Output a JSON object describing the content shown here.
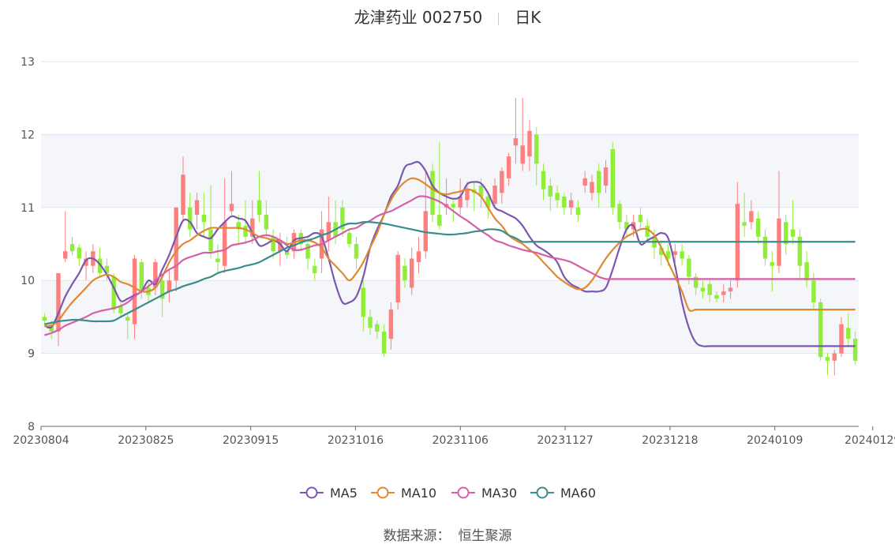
{
  "header": {
    "title": "龙津药业 002750",
    "period": "日K"
  },
  "source": {
    "label": "数据来源：",
    "value": "恒生聚源"
  },
  "colors": {
    "up": "#ff7f7f",
    "down": "#90ee3a",
    "ma5": "#7a58b0",
    "ma10": "#e08a30",
    "ma30": "#d461a8",
    "ma60": "#3b8c8c",
    "grid": "#dfe4f0",
    "band": "#f5f6fa"
  },
  "chart_data": {
    "type": "candlestick",
    "title": "龙津药业 002750",
    "ylim": [
      8,
      13
    ],
    "y_ticks": [
      "8",
      "9",
      "10",
      "11",
      "12",
      "13"
    ],
    "x_tick_labels": [
      "20230804",
      "20230825",
      "20230915",
      "20231016",
      "20231106",
      "20231127",
      "20231218",
      "20240109",
      "20240129"
    ],
    "x_tick_index": [
      0,
      15,
      30,
      45,
      60,
      75,
      90,
      105,
      119
    ],
    "legend_position": "bottom",
    "series": [
      {
        "name": "MA5",
        "color": "#7a58b0",
        "values": [
          9.38,
          9.36,
          9.55,
          9.78,
          9.95,
          10.1,
          10.28,
          10.3,
          10.22,
          10.08,
          9.9,
          9.72,
          9.75,
          9.8,
          9.85,
          10.0,
          9.95,
          10.15,
          10.35,
          10.6,
          10.82,
          10.8,
          10.65,
          10.6,
          10.58,
          10.7,
          10.8,
          10.88,
          10.85,
          10.82,
          10.65,
          10.48,
          10.5,
          10.55,
          10.5,
          10.4,
          10.55,
          10.58,
          10.6,
          10.65,
          10.6,
          10.3,
          9.95,
          9.7,
          9.7,
          9.78,
          10.05,
          10.45,
          10.7,
          10.9,
          11.15,
          11.3,
          11.55,
          11.6,
          11.62,
          11.5,
          11.3,
          11.2,
          11.15,
          11.12,
          11.15,
          11.32,
          11.35,
          11.33,
          11.2,
          11.0,
          10.95,
          10.9,
          10.85,
          10.75,
          10.6,
          10.48,
          10.42,
          10.35,
          10.25,
          10.05,
          9.95,
          9.9,
          9.85,
          9.85,
          9.85,
          9.9,
          10.15,
          10.45,
          10.7,
          10.75,
          10.5,
          10.55,
          10.6,
          10.65,
          10.58,
          10.2,
          9.7,
          9.35,
          9.15,
          9.1,
          9.1,
          9.1,
          9.1,
          9.1,
          9.1,
          9.1,
          9.1,
          9.1,
          9.1,
          9.1,
          9.1,
          9.1,
          9.1,
          9.1,
          9.1,
          9.1,
          9.1,
          9.1,
          9.1,
          9.1,
          9.1,
          9.1,
          9.1,
          9.1
        ]
      },
      {
        "name": "MA10",
        "color": "#e08a30",
        "values": [
          9.38,
          9.38,
          9.45,
          9.58,
          9.7,
          9.8,
          9.9,
          10.0,
          10.05,
          10.08,
          10.05,
          9.98,
          9.95,
          9.9,
          9.85,
          9.85,
          9.9,
          10.05,
          10.25,
          10.4,
          10.5,
          10.55,
          10.62,
          10.68,
          10.72,
          10.72,
          10.72,
          10.72,
          10.72,
          10.7,
          10.65,
          10.6,
          10.58,
          10.55,
          10.55,
          10.5,
          10.52,
          10.55,
          10.55,
          10.52,
          10.45,
          10.3,
          10.2,
          10.1,
          10.0,
          10.1,
          10.25,
          10.45,
          10.65,
          10.9,
          11.1,
          11.25,
          11.35,
          11.4,
          11.38,
          11.32,
          11.25,
          11.2,
          11.18,
          11.2,
          11.22,
          11.25,
          11.22,
          11.15,
          11.0,
          10.85,
          10.75,
          10.62,
          10.55,
          10.5,
          10.42,
          10.35,
          10.25,
          10.15,
          10.05,
          9.98,
          9.92,
          9.88,
          9.9,
          10.0,
          10.15,
          10.3,
          10.42,
          10.52,
          10.6,
          10.65,
          10.7,
          10.7,
          10.62,
          10.45,
          10.25,
          10.05,
          9.85,
          9.6,
          9.6,
          9.6,
          9.6,
          9.6,
          9.6,
          9.6,
          9.6,
          9.6,
          9.6,
          9.6,
          9.6,
          9.6,
          9.6,
          9.6,
          9.6,
          9.6,
          9.6,
          9.6,
          9.6,
          9.6,
          9.6,
          9.6,
          9.6,
          9.6,
          9.6,
          9.6
        ]
      },
      {
        "name": "MA30",
        "color": "#d461a8",
        "values": [
          9.25,
          9.28,
          9.32,
          9.38,
          9.42,
          9.46,
          9.5,
          9.55,
          9.58,
          9.6,
          9.62,
          9.65,
          9.7,
          9.78,
          9.85,
          9.92,
          10.0,
          10.08,
          10.15,
          10.2,
          10.28,
          10.32,
          10.35,
          10.38,
          10.38,
          10.4,
          10.42,
          10.48,
          10.5,
          10.52,
          10.55,
          10.6,
          10.62,
          10.6,
          10.55,
          10.48,
          10.42,
          10.42,
          10.45,
          10.48,
          10.5,
          10.55,
          10.6,
          10.65,
          10.7,
          10.72,
          10.78,
          10.82,
          10.88,
          10.92,
          10.95,
          11.0,
          11.05,
          11.1,
          11.15,
          11.15,
          11.12,
          11.08,
          11.02,
          10.95,
          10.88,
          10.82,
          10.75,
          10.68,
          10.62,
          10.55,
          10.52,
          10.48,
          10.45,
          10.42,
          10.4,
          10.38,
          10.35,
          10.32,
          10.3,
          10.28,
          10.25,
          10.2,
          10.15,
          10.1,
          10.05,
          10.02,
          10.02,
          10.02,
          10.02,
          10.02,
          10.02,
          10.02,
          10.02,
          10.02,
          10.02,
          10.02,
          10.02,
          10.02,
          10.02,
          10.02,
          10.02,
          10.02,
          10.02,
          10.02,
          10.02,
          10.02,
          10.02,
          10.02,
          10.02,
          10.02,
          10.02,
          10.02,
          10.02,
          10.02,
          10.02,
          10.02,
          10.02,
          10.02,
          10.02,
          10.02,
          10.02,
          10.02,
          10.02,
          10.02
        ]
      },
      {
        "name": "MA60",
        "color": "#3b8c8c",
        "values": [
          9.4,
          9.42,
          9.44,
          9.45,
          9.46,
          9.46,
          9.45,
          9.44,
          9.44,
          9.44,
          9.45,
          9.5,
          9.55,
          9.6,
          9.65,
          9.7,
          9.75,
          9.8,
          9.85,
          9.88,
          9.92,
          9.95,
          9.98,
          10.02,
          10.05,
          10.1,
          10.13,
          10.15,
          10.17,
          10.2,
          10.22,
          10.25,
          10.3,
          10.35,
          10.4,
          10.45,
          10.48,
          10.52,
          10.55,
          10.58,
          10.62,
          10.65,
          10.7,
          10.75,
          10.78,
          10.78,
          10.8,
          10.8,
          10.79,
          10.78,
          10.76,
          10.74,
          10.72,
          10.7,
          10.68,
          10.66,
          10.65,
          10.64,
          10.63,
          10.63,
          10.64,
          10.65,
          10.67,
          10.68,
          10.7,
          10.7,
          10.68,
          10.62,
          10.58,
          10.53,
          10.53,
          10.53,
          10.53,
          10.53,
          10.53,
          10.53,
          10.53,
          10.53,
          10.53,
          10.53,
          10.53,
          10.53,
          10.53,
          10.53,
          10.53,
          10.53,
          10.53,
          10.53,
          10.53,
          10.53,
          10.53,
          10.53,
          10.53,
          10.53,
          10.53,
          10.53,
          10.53,
          10.53,
          10.53,
          10.53,
          10.53,
          10.53,
          10.53,
          10.53,
          10.53,
          10.53,
          10.53,
          10.53,
          10.53,
          10.53,
          10.53,
          10.53,
          10.53,
          10.53,
          10.53,
          10.53,
          10.53,
          10.53,
          10.53,
          10.53
        ]
      }
    ],
    "candles": [
      [
        9.5,
        9.45,
        9.55,
        9.4
      ],
      [
        9.4,
        9.3,
        9.45,
        9.2
      ],
      [
        9.3,
        10.1,
        10.1,
        9.1
      ],
      [
        10.3,
        10.4,
        10.95,
        10.25
      ],
      [
        10.5,
        10.4,
        10.6,
        10.35
      ],
      [
        10.45,
        10.3,
        10.5,
        10.2
      ],
      [
        10.2,
        10.3,
        10.4,
        10.0
      ],
      [
        10.2,
        10.4,
        10.5,
        10.1
      ],
      [
        10.3,
        10.1,
        10.45,
        10.05
      ],
      [
        10.2,
        10.1,
        10.3,
        10.0
      ],
      [
        10.05,
        9.6,
        10.1,
        9.55
      ],
      [
        9.65,
        9.55,
        9.7,
        9.5
      ],
      [
        9.5,
        9.45,
        9.55,
        9.2
      ],
      [
        9.4,
        10.3,
        10.35,
        9.2
      ],
      [
        10.25,
        9.85,
        10.3,
        9.75
      ],
      [
        9.9,
        9.8,
        10.0,
        9.7
      ],
      [
        9.9,
        10.25,
        10.3,
        9.8
      ],
      [
        10.0,
        9.75,
        10.05,
        9.5
      ],
      [
        9.85,
        10.0,
        10.15,
        9.7
      ],
      [
        10.0,
        11.0,
        11.0,
        9.85
      ],
      [
        10.9,
        11.45,
        11.7,
        10.8
      ],
      [
        11.0,
        10.7,
        11.2,
        10.6
      ],
      [
        10.9,
        11.1,
        11.2,
        10.7
      ],
      [
        10.9,
        10.8,
        11.2,
        10.6
      ],
      [
        10.7,
        10.4,
        11.3,
        10.3
      ],
      [
        10.3,
        10.25,
        10.5,
        10.1
      ],
      [
        10.2,
        10.8,
        11.4,
        10.1
      ],
      [
        10.95,
        11.05,
        11.5,
        10.9
      ],
      [
        10.8,
        10.7,
        10.9,
        10.5
      ],
      [
        10.75,
        10.6,
        11.1,
        10.5
      ],
      [
        10.6,
        10.85,
        11.1,
        10.5
      ],
      [
        11.1,
        10.9,
        11.5,
        10.8
      ],
      [
        10.9,
        10.7,
        11.1,
        10.6
      ],
      [
        10.6,
        10.4,
        10.7,
        10.3
      ],
      [
        10.4,
        10.55,
        10.65,
        10.2
      ],
      [
        10.4,
        10.35,
        10.6,
        10.3
      ],
      [
        10.4,
        10.65,
        10.7,
        10.3
      ],
      [
        10.65,
        10.5,
        10.7,
        10.4
      ],
      [
        10.5,
        10.3,
        10.6,
        10.15
      ],
      [
        10.2,
        10.1,
        10.3,
        10.0
      ],
      [
        10.3,
        10.7,
        10.95,
        10.1
      ],
      [
        10.55,
        10.8,
        11.15,
        10.4
      ],
      [
        10.8,
        10.6,
        11.1,
        10.5
      ],
      [
        11.0,
        10.7,
        11.1,
        10.6
      ],
      [
        10.65,
        10.5,
        10.7,
        10.45
      ],
      [
        10.5,
        10.3,
        10.6,
        10.15
      ],
      [
        9.9,
        9.5,
        10.0,
        9.3
      ],
      [
        9.5,
        9.35,
        9.6,
        9.25
      ],
      [
        9.4,
        9.3,
        9.45,
        9.2
      ],
      [
        9.3,
        9.0,
        9.4,
        8.95
      ],
      [
        9.2,
        9.6,
        9.7,
        9.05
      ],
      [
        9.7,
        10.35,
        10.4,
        9.6
      ],
      [
        10.2,
        10.0,
        10.3,
        9.9
      ],
      [
        9.9,
        10.3,
        10.45,
        9.8
      ],
      [
        10.25,
        10.4,
        10.6,
        10.1
      ],
      [
        10.4,
        10.95,
        11.5,
        10.3
      ],
      [
        11.5,
        10.9,
        11.6,
        10.8
      ],
      [
        10.9,
        10.75,
        11.9,
        10.7
      ],
      [
        11.0,
        11.05,
        11.4,
        10.9
      ],
      [
        11.05,
        11.0,
        11.1,
        10.8
      ],
      [
        11.0,
        11.15,
        11.4,
        10.9
      ],
      [
        11.1,
        11.25,
        11.35,
        11.0
      ],
      [
        11.25,
        11.2,
        11.35,
        10.95
      ],
      [
        11.3,
        11.15,
        11.4,
        11.0
      ],
      [
        11.15,
        11.0,
        11.2,
        10.85
      ],
      [
        11.05,
        11.3,
        11.4,
        11.0
      ],
      [
        11.2,
        11.5,
        11.55,
        11.05
      ],
      [
        11.4,
        11.7,
        11.75,
        11.3
      ],
      [
        11.85,
        11.95,
        12.5,
        11.6
      ],
      [
        11.6,
        11.85,
        12.5,
        11.5
      ],
      [
        11.7,
        12.05,
        12.2,
        11.5
      ],
      [
        12.0,
        11.6,
        12.1,
        11.3
      ],
      [
        11.5,
        11.25,
        11.6,
        11.1
      ],
      [
        11.3,
        11.15,
        11.4,
        10.95
      ],
      [
        11.2,
        11.1,
        11.3,
        11.0
      ],
      [
        11.15,
        11.0,
        11.2,
        10.9
      ],
      [
        11.0,
        11.1,
        11.2,
        10.9
      ],
      [
        11.0,
        10.9,
        11.1,
        10.8
      ],
      [
        11.3,
        11.4,
        11.5,
        11.2
      ],
      [
        11.2,
        11.35,
        11.45,
        11.1
      ],
      [
        11.5,
        11.2,
        11.6,
        11.0
      ],
      [
        11.3,
        11.55,
        11.65,
        11.2
      ],
      [
        11.8,
        11.0,
        11.9,
        10.9
      ],
      [
        11.05,
        10.8,
        11.1,
        10.7
      ],
      [
        10.8,
        10.7,
        10.9,
        10.6
      ],
      [
        10.7,
        10.8,
        10.9,
        10.6
      ],
      [
        10.9,
        10.8,
        11.0,
        10.7
      ],
      [
        10.75,
        10.6,
        10.85,
        10.55
      ],
      [
        10.6,
        10.45,
        10.7,
        10.3
      ],
      [
        10.45,
        10.35,
        10.55,
        10.2
      ],
      [
        10.4,
        10.3,
        10.5,
        10.2
      ],
      [
        10.35,
        10.4,
        10.5,
        10.25
      ],
      [
        10.4,
        10.3,
        10.5,
        10.2
      ],
      [
        10.3,
        10.05,
        10.35,
        9.95
      ],
      [
        10.05,
        9.9,
        10.1,
        9.8
      ],
      [
        9.9,
        9.85,
        10.0,
        9.75
      ],
      [
        9.95,
        9.8,
        10.0,
        9.7
      ],
      [
        9.8,
        9.75,
        9.85,
        9.7
      ],
      [
        9.8,
        9.85,
        9.95,
        9.7
      ],
      [
        9.85,
        9.9,
        10.0,
        9.75
      ],
      [
        10.0,
        11.05,
        11.35,
        9.9
      ],
      [
        10.8,
        10.75,
        11.2,
        10.6
      ],
      [
        10.8,
        10.95,
        11.1,
        10.7
      ],
      [
        10.85,
        10.6,
        10.95,
        10.5
      ],
      [
        10.6,
        10.3,
        10.7,
        10.2
      ],
      [
        10.25,
        10.2,
        10.4,
        9.85
      ],
      [
        10.2,
        10.85,
        11.5,
        10.1
      ],
      [
        10.8,
        10.5,
        10.9,
        10.35
      ],
      [
        10.7,
        10.6,
        11.1,
        10.5
      ],
      [
        10.6,
        10.2,
        10.7,
        10.0
      ],
      [
        10.25,
        10.0,
        10.4,
        9.9
      ],
      [
        10.0,
        9.7,
        10.1,
        9.6
      ],
      [
        9.7,
        8.95,
        9.75,
        8.9
      ],
      [
        8.95,
        8.9,
        9.0,
        8.7
      ],
      [
        8.9,
        9.0,
        9.05,
        8.7
      ],
      [
        9.0,
        9.4,
        9.5,
        8.95
      ],
      [
        9.35,
        9.2,
        9.55,
        9.1
      ],
      [
        9.2,
        8.9,
        9.3,
        8.85
      ]
    ]
  }
}
